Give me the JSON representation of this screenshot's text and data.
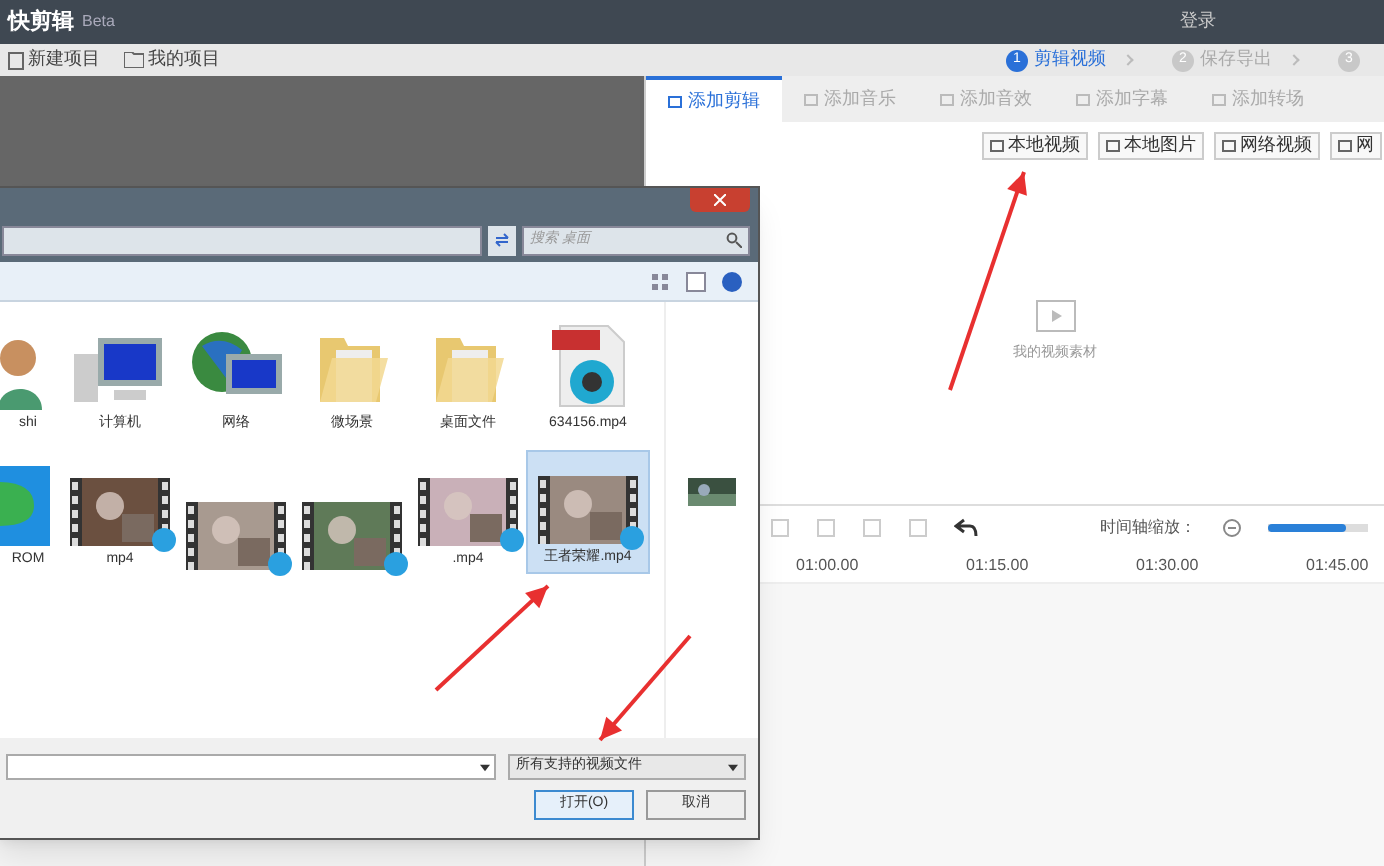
{
  "app": {
    "title": "快剪辑",
    "badge": "Beta",
    "login": "登录"
  },
  "toolbar": [
    {
      "label": "新建项目",
      "kind": "new"
    },
    {
      "label": "我的项目",
      "kind": "folder"
    }
  ],
  "steps": [
    {
      "number": "1",
      "label": "剪辑视频",
      "selected": true
    },
    {
      "number": "2",
      "label": "保存导出",
      "selected": false
    },
    {
      "number": "3",
      "selected": false
    }
  ],
  "tabs": [
    {
      "label": "添加剪辑",
      "selected": true
    },
    {
      "label": "添加音乐",
      "selected": false
    },
    {
      "label": "添加音效",
      "selected": false
    },
    {
      "label": "添加字幕",
      "selected": false
    },
    {
      "label": "添加转场",
      "selected": false
    }
  ],
  "source_buttons": [
    "本地视频",
    "本地图片",
    "网络视频",
    "网"
  ],
  "empty_label": "我的视频素材",
  "timeline": {
    "zoom_label": "时间轴缩放：",
    "level": 0.78,
    "ticks": [
      "01:00.00",
      "01:15.00",
      "01:30.00",
      "01:45.00"
    ]
  },
  "dialog": {
    "search_placeholder": "搜索 桌面",
    "files": [
      {
        "name": "shi",
        "kind": "user",
        "selected": false
      },
      {
        "name": "计算机",
        "kind": "computer",
        "selected": false
      },
      {
        "name": "网络",
        "kind": "network",
        "selected": false
      },
      {
        "name": "微场景",
        "kind": "folder",
        "selected": false
      },
      {
        "name": "桌面文件",
        "kind": "folder",
        "selected": false
      },
      {
        "name": "634156.mp4",
        "kind": "mp4",
        "selected": false
      },
      {
        "name": "ROM",
        "kind": "app",
        "selected": false
      },
      {
        "name": "mp4",
        "kind": "video",
        "selected": false
      },
      {
        "kind": "video",
        "selected": false
      },
      {
        "kind": "video",
        "selected": false
      },
      {
        "name": ".mp4",
        "kind": "video",
        "selected": false
      },
      {
        "name": "王者荣耀.mp4",
        "kind": "video",
        "selected": true
      }
    ],
    "file_type": "所有支持的视频文件",
    "buttons": [
      "打开(O)",
      "取消"
    ]
  }
}
